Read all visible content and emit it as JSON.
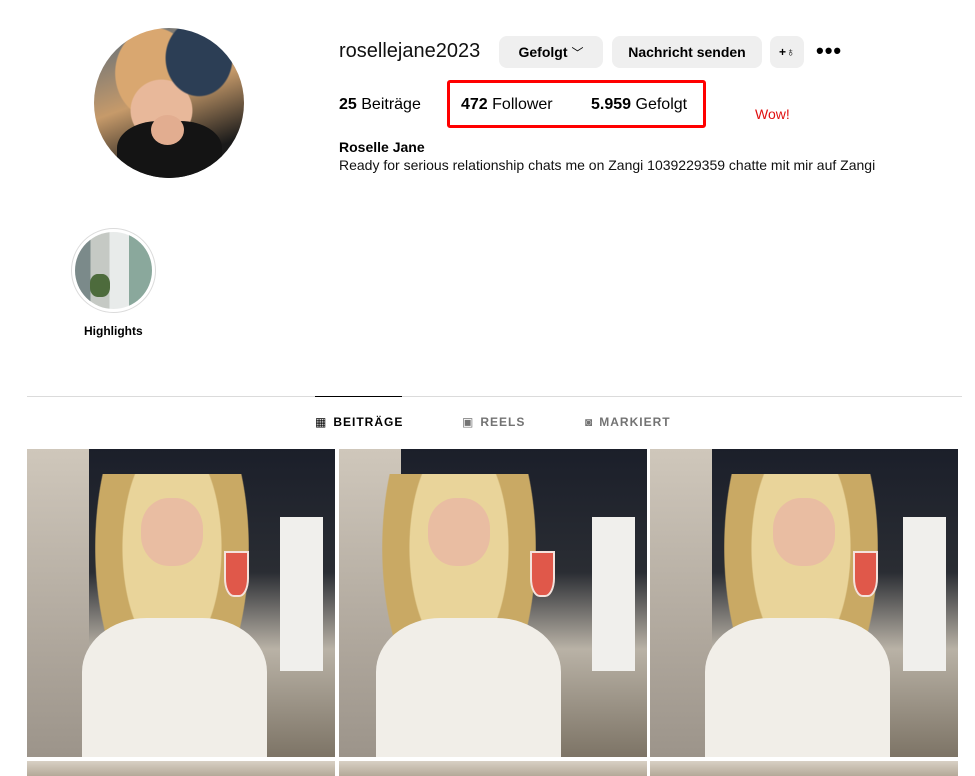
{
  "profile": {
    "username": "rosellejane2023",
    "full_name": "Roselle Jane",
    "bio": "Ready for serious relationship chats me on Zangi 1039229359 chatte mit mir auf Zangi"
  },
  "actions": {
    "follow_label": "Gefolgt",
    "follow_chevron": "﹀",
    "message_label": "Nachricht senden",
    "add_user_label": "+♁",
    "more_label": "•••"
  },
  "stats": {
    "posts_count": "25",
    "posts_label": "Beiträge",
    "followers_count": "472",
    "followers_label": "Follower",
    "following_count": "5.959",
    "following_label": "Gefolgt"
  },
  "annotation": {
    "note": "Wow!",
    "box_color": "#ff0000"
  },
  "highlights": [
    {
      "label": "Highlights"
    }
  ],
  "tabs": [
    {
      "label": "BEITRÄGE",
      "icon": "grid-icon",
      "glyph": "▦",
      "active": true
    },
    {
      "label": "REELS",
      "icon": "reels-icon",
      "glyph": "▣",
      "active": false
    },
    {
      "label": "MARKIERT",
      "icon": "tagged-icon",
      "glyph": "◙",
      "active": false
    }
  ],
  "posts_grid": {
    "visible_rows": 1,
    "items": [
      "photo-1",
      "photo-2",
      "photo-3"
    ]
  }
}
